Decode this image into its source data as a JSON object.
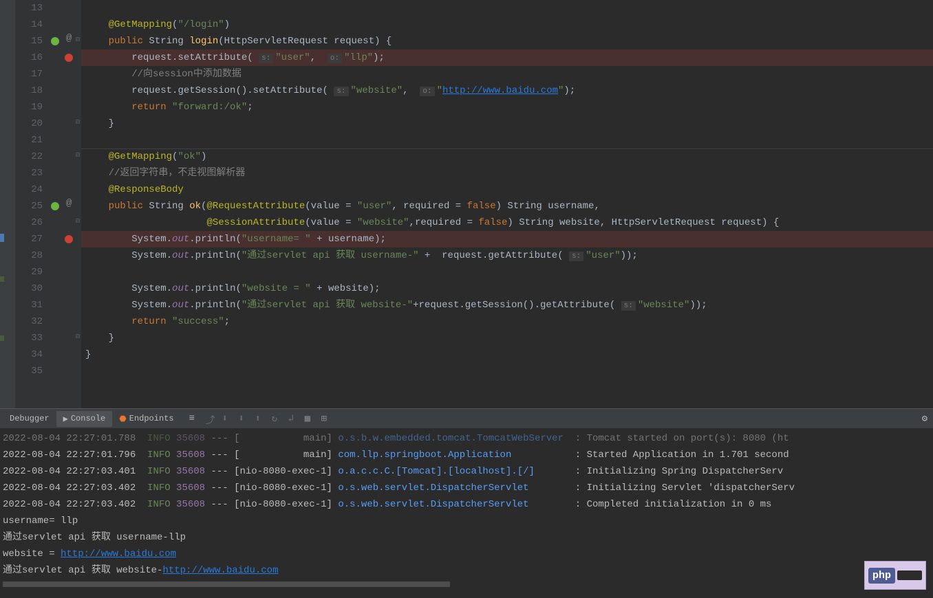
{
  "lines": {
    "start": 13,
    "end": 35
  },
  "gutter": {
    "spring_lines": [
      15,
      25
    ],
    "at_lines": [
      15,
      25
    ],
    "breakpoint_lines": [
      16,
      27
    ],
    "fold_lines": [
      15,
      20,
      22,
      26,
      33
    ]
  },
  "code": {
    "l14": {
      "annotation": "@GetMapping",
      "paren_open": "(",
      "str": "\"/login\"",
      "paren_close": ")"
    },
    "l15": {
      "kw": "public ",
      "type": "String ",
      "method": "login",
      "paren": "(",
      "param_type": "HttpServletRequest ",
      "param_name": "request",
      "close": ") {"
    },
    "l16": {
      "indent": "        ",
      "obj": "request",
      "dot": ".",
      "call": "setAttribute",
      "paren": "( ",
      "hint1": "s:",
      "str1": "\"user\"",
      "comma": ", ",
      "hint2": "o:",
      "str2": "\"llp\"",
      "close": ");"
    },
    "l17": {
      "comment": "//向session中添加数据"
    },
    "l18": {
      "indent": "        ",
      "obj": "request",
      "dot1": ".",
      "call1": "getSession",
      "p1": "()",
      "dot2": ".",
      "call2": "setAttribute",
      "paren": "( ",
      "hint1": "s:",
      "str1": "\"website\"",
      "comma": ", ",
      "hint2": "o:",
      "q1": "\"",
      "url": "http://www.baidu.com",
      "q2": "\"",
      "close": ");"
    },
    "l19": {
      "kw": "return ",
      "str": "\"forward:/ok\"",
      "semi": ";"
    },
    "l20": {
      "brace": "}"
    },
    "l22": {
      "annotation": "@GetMapping",
      "paren_open": "(",
      "str": "\"ok\"",
      "paren_close": ")"
    },
    "l23": {
      "comment": "//返回字符串，不走视图解析器"
    },
    "l24": {
      "annotation": "@ResponseBody"
    },
    "l25": {
      "kw": "public ",
      "type": "String ",
      "method": "ok",
      "paren": "(",
      "anno": "@RequestAttribute",
      "p2": "(",
      "vkey": "value ",
      "eq": "= ",
      "str": "\"user\"",
      "comma1": ", ",
      "rkey": "required ",
      "eq2": "= ",
      "false": "false",
      "p3": ") ",
      "ptype": "String ",
      "pname": "username",
      "comma2": ","
    },
    "l26": {
      "anno": "@SessionAttribute",
      "p2": "(",
      "vkey": "value ",
      "eq": "= ",
      "str": "\"website\"",
      "comma1": ",",
      "rkey": "required ",
      "eq2": "= ",
      "false": "false",
      "p3": ") ",
      "ptype": "String ",
      "pname": "website",
      "comma2": ", ",
      "ptype2": "HttpServletRequest ",
      "pname2": "request",
      "close": ") {"
    },
    "l27": {
      "sys": "System",
      "dot": ".",
      "out": "out",
      "dot2": ".",
      "call": "println",
      "paren": "(",
      "str": "\"username= \"",
      "plus": " + ",
      "var": "username",
      "close": ");"
    },
    "l28": {
      "sys": "System",
      "dot": ".",
      "out": "out",
      "dot2": ".",
      "call": "println",
      "paren": "(",
      "str": "\"通过servlet api 获取 username-\"",
      "plus": " +  ",
      "obj": "request",
      "dot3": ".",
      "call2": "getAttribute",
      "p2": "( ",
      "hint": "s:",
      "str2": "\"user\"",
      "close": "));"
    },
    "l30": {
      "sys": "System",
      "dot": ".",
      "out": "out",
      "dot2": ".",
      "call": "println",
      "paren": "(",
      "str": "\"website = \"",
      "plus": " + ",
      "var": "website",
      "close": ");"
    },
    "l31": {
      "sys": "System",
      "dot": ".",
      "out": "out",
      "dot2": ".",
      "call": "println",
      "paren": "(",
      "str": "\"通过servlet api 获取 website-\"",
      "plus": "+",
      "obj": "request",
      "dot3": ".",
      "call2": "getSession",
      "p2": "()",
      "dot4": ".",
      "call3": "getAttribute",
      "p3": "( ",
      "hint": "s:",
      "str2": "\"website\"",
      "close": "));"
    },
    "l32": {
      "kw": "return ",
      "str": "\"success\"",
      "semi": ";"
    },
    "l33": {
      "brace": "}"
    },
    "l34": {
      "brace": "}"
    }
  },
  "tabs": {
    "debugger": "Debugger",
    "console": "Console",
    "endpoints": "Endpoints"
  },
  "console": {
    "l0": {
      "ts": "2022-08-04 22:27:01.788  ",
      "level": "INFO",
      "pid": " 35608",
      "dash": " --- [           main] ",
      "logger": "o.s.b.w.embedded.tomcat.TomcatWebServer",
      "rest": "  : Tomcat started on port(s): 8080 (ht"
    },
    "l1": {
      "ts": "2022-08-04 22:27:01.796  ",
      "level": "INFO",
      "pid": " 35608",
      "dash": " --- [           main] ",
      "logger": "com.llp.springboot.Application",
      "rest": "           : Started Application in 1.701 second"
    },
    "l2": {
      "ts": "2022-08-04 22:27:03.401  ",
      "level": "INFO",
      "pid": " 35608",
      "dash": " --- [nio-8080-exec-1] ",
      "logger": "o.a.c.c.C.[Tomcat].[localhost].[/]",
      "rest": "       : Initializing Spring DispatcherServ"
    },
    "l3": {
      "ts": "2022-08-04 22:27:03.402  ",
      "level": "INFO",
      "pid": " 35608",
      "dash": " --- [nio-8080-exec-1] ",
      "logger": "o.s.web.servlet.DispatcherServlet",
      "rest": "        : Initializing Servlet 'dispatcherServ"
    },
    "l4": {
      "ts": "2022-08-04 22:27:03.402  ",
      "level": "INFO",
      "pid": " 35608",
      "dash": " --- [nio-8080-exec-1] ",
      "logger": "o.s.web.servlet.DispatcherServlet",
      "rest": "        : Completed initialization in 0 ms"
    },
    "l5": {
      "text": "username= llp"
    },
    "l6": {
      "text": "通过servlet api 获取 username-llp"
    },
    "l7": {
      "pre": "website = ",
      "url": "http://www.baidu.com"
    },
    "l8": {
      "pre": "通过servlet api 获取 website-",
      "url": "http://www.baidu.com"
    }
  },
  "badge": {
    "php": "php"
  }
}
